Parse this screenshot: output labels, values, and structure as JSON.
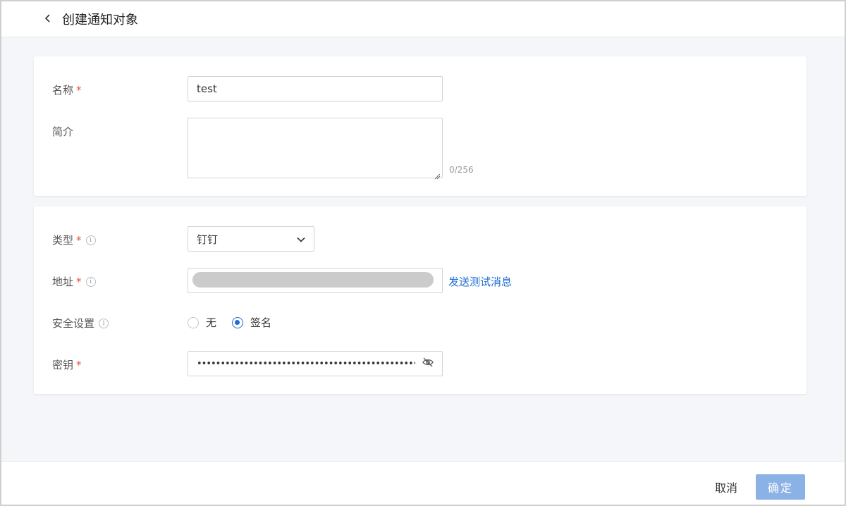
{
  "header": {
    "title": "创建通知对象"
  },
  "form": {
    "name": {
      "label": "名称",
      "required_mark": "*",
      "value": "test"
    },
    "description": {
      "label": "简介",
      "counter": "0/256"
    },
    "type": {
      "label": "类型",
      "required_mark": "*",
      "selected": "钉钉"
    },
    "address": {
      "label": "地址",
      "required_mark": "*",
      "send_test_label": "发送测试消息"
    },
    "security": {
      "label": "安全设置",
      "options": [
        {
          "label": "无",
          "checked": false
        },
        {
          "label": "签名",
          "checked": true
        }
      ]
    },
    "secret": {
      "label": "密钥",
      "required_mark": "*",
      "masked_value": "••••••••••••••••••••••••••••••••••••••••••••••••"
    }
  },
  "footer": {
    "cancel_label": "取消",
    "confirm_label": "确定"
  },
  "colors": {
    "accent": "#1f6fd1",
    "required": "#e0524d",
    "confirm_disabled": "#8ab2e6"
  }
}
